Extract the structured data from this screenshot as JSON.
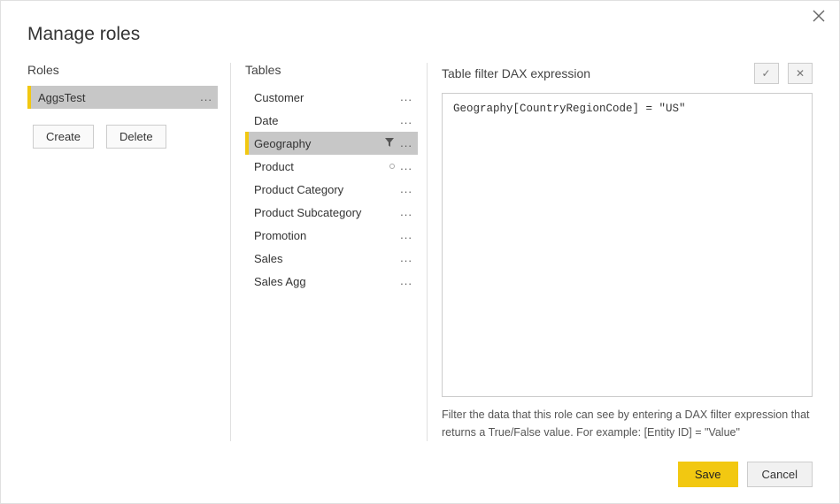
{
  "title": "Manage roles",
  "roles": {
    "header": "Roles",
    "items": [
      {
        "name": "AggsTest",
        "selected": true
      }
    ],
    "create_label": "Create",
    "delete_label": "Delete"
  },
  "tables": {
    "header": "Tables",
    "items": [
      {
        "name": "Customer",
        "selected": false,
        "hasFilter": false,
        "hasCircle": false
      },
      {
        "name": "Date",
        "selected": false,
        "hasFilter": false,
        "hasCircle": false
      },
      {
        "name": "Geography",
        "selected": true,
        "hasFilter": true,
        "hasCircle": false
      },
      {
        "name": "Product",
        "selected": false,
        "hasFilter": false,
        "hasCircle": true
      },
      {
        "name": "Product Category",
        "selected": false,
        "hasFilter": false,
        "hasCircle": false
      },
      {
        "name": "Product Subcategory",
        "selected": false,
        "hasFilter": false,
        "hasCircle": false
      },
      {
        "name": "Promotion",
        "selected": false,
        "hasFilter": false,
        "hasCircle": false
      },
      {
        "name": "Sales",
        "selected": false,
        "hasFilter": false,
        "hasCircle": false
      },
      {
        "name": "Sales Agg",
        "selected": false,
        "hasFilter": false,
        "hasCircle": false
      }
    ]
  },
  "dax": {
    "header": "Table filter DAX expression",
    "expression": "Geography[CountryRegionCode] = \"US\"",
    "help": "Filter the data that this role can see by entering a DAX filter expression that returns a True/False value. For example: [Entity ID] = \"Value\"",
    "accept_symbol": "✓",
    "cancel_symbol": "✕"
  },
  "footer": {
    "save_label": "Save",
    "cancel_label": "Cancel"
  }
}
